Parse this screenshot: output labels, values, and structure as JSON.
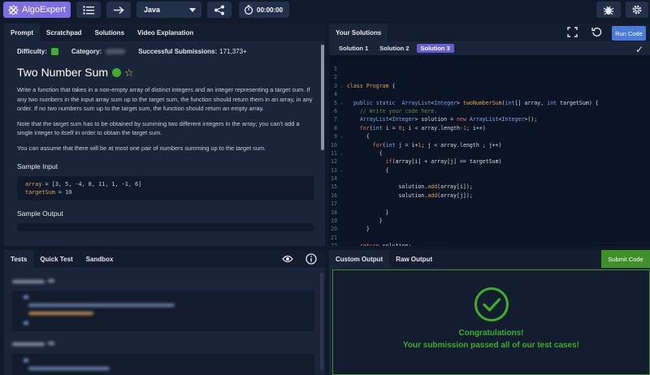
{
  "topbar": {
    "logo_text": "AlgoExpert",
    "language": "Java",
    "timer": "00:00:00"
  },
  "prompt_panel": {
    "tabs": [
      "Prompt",
      "Scratchpad",
      "Solutions",
      "Video Explanation"
    ],
    "difficulty_label": "Difficulty:",
    "category_label": "Category:",
    "submissions_label": "Successful Submissions:",
    "submissions_value": "171,373+",
    "title": "Two Number Sum",
    "description": [
      "Write a function that takes in a non-empty array of distinct integers and an integer representing a target sum. If any two numbers in the input array sum up to the target sum, the function should return them in an array, in any order. If no two numbers sum up to the target sum, the function should return an empty array.",
      "Note that the target sum has to be obtained by summing two different integers in the array; you can't add a single integer to itself in order to obtain the target sum.",
      "You can assume that there will be at most one pair of numbers summing up to the target sum."
    ],
    "sample_input_label": "Sample Input",
    "sample_input_line1_key": "array",
    "sample_input_line1_val": " = [3, 5, -4, 8, 11, 1, -1, 6]",
    "sample_input_line2_key": "targetSum",
    "sample_input_line2_val": " = 10",
    "sample_output_label": "Sample Output"
  },
  "solutions_panel": {
    "header": "Your Solutions",
    "run_label": "Run Code",
    "solution_tabs": [
      "Solution 1",
      "Solution 2",
      "Solution 3"
    ],
    "active_solution": "Solution 3",
    "code_lines": [
      {
        "n": "1",
        "fold": "",
        "tokens": [
          {
            "c": "c-txt",
            "t": ""
          }
        ]
      },
      {
        "n": "2",
        "fold": "",
        "tokens": [
          {
            "c": "c-txt",
            "t": ""
          }
        ]
      },
      {
        "n": "3",
        "fold": "⌄",
        "tokens": [
          {
            "c": "c-ora",
            "t": "class "
          },
          {
            "c": "c-ora",
            "t": "Program"
          },
          {
            "c": "c-txt",
            "t": " {"
          }
        ]
      },
      {
        "n": "4",
        "fold": "",
        "tokens": [
          {
            "c": "c-txt",
            "t": ""
          }
        ]
      },
      {
        "n": "5",
        "fold": "⌄",
        "tokens": [
          {
            "c": "c-txt",
            "t": "  "
          },
          {
            "c": "c-blue",
            "t": "public static  "
          },
          {
            "c": "c-blue",
            "t": "ArrayList"
          },
          {
            "c": "c-txt",
            "t": "<"
          },
          {
            "c": "c-blue",
            "t": "Integer"
          },
          {
            "c": "c-txt",
            "t": "> "
          },
          {
            "c": "c-ora",
            "t": "twoNumberSum"
          },
          {
            "c": "c-txt",
            "t": "("
          },
          {
            "c": "c-blue",
            "t": "int"
          },
          {
            "c": "c-txt",
            "t": "[] array, "
          },
          {
            "c": "c-blue",
            "t": "int"
          },
          {
            "c": "c-txt",
            "t": " targetSum) {"
          }
        ]
      },
      {
        "n": "6",
        "fold": "",
        "tokens": [
          {
            "c": "c-cm",
            "t": "    // Write your code here."
          }
        ]
      },
      {
        "n": "7",
        "fold": "",
        "tokens": [
          {
            "c": "c-txt",
            "t": "    "
          },
          {
            "c": "c-blue",
            "t": "ArrayList"
          },
          {
            "c": "c-txt",
            "t": "<"
          },
          {
            "c": "c-blue",
            "t": "Integer"
          },
          {
            "c": "c-txt",
            "t": "> solution = "
          },
          {
            "c": "c-red",
            "t": "new "
          },
          {
            "c": "c-blue",
            "t": "ArrayList"
          },
          {
            "c": "c-txt",
            "t": "<"
          },
          {
            "c": "c-blue",
            "t": "Integer"
          },
          {
            "c": "c-txt",
            "t": ">();"
          }
        ]
      },
      {
        "n": "8",
        "fold": "",
        "tokens": [
          {
            "c": "c-txt",
            "t": "    "
          },
          {
            "c": "c-red",
            "t": "for"
          },
          {
            "c": "c-txt",
            "t": "("
          },
          {
            "c": "c-blue",
            "t": "int"
          },
          {
            "c": "c-txt",
            "t": " i = "
          },
          {
            "c": "c-red",
            "t": "0"
          },
          {
            "c": "c-txt",
            "t": "; i < array.length-"
          },
          {
            "c": "c-red",
            "t": "1"
          },
          {
            "c": "c-txt",
            "t": "; i++)"
          }
        ]
      },
      {
        "n": "9",
        "fold": "⌄",
        "tokens": [
          {
            "c": "c-txt",
            "t": "      {"
          }
        ]
      },
      {
        "n": "10",
        "fold": "",
        "tokens": [
          {
            "c": "c-txt",
            "t": "        "
          },
          {
            "c": "c-red",
            "t": "for"
          },
          {
            "c": "c-txt",
            "t": "("
          },
          {
            "c": "c-blue",
            "t": "int"
          },
          {
            "c": "c-txt",
            "t": " j = i+"
          },
          {
            "c": "c-red",
            "t": "1"
          },
          {
            "c": "c-txt",
            "t": "; j < array.length ; j++)"
          }
        ]
      },
      {
        "n": "11",
        "fold": "⌄",
        "tokens": [
          {
            "c": "c-txt",
            "t": "          {"
          }
        ]
      },
      {
        "n": "12",
        "fold": "",
        "tokens": [
          {
            "c": "c-txt",
            "t": "            "
          },
          {
            "c": "c-red",
            "t": "if"
          },
          {
            "c": "c-txt",
            "t": "(array[i] + array[j] == targetSum)"
          }
        ]
      },
      {
        "n": "13",
        "fold": "⌄",
        "tokens": [
          {
            "c": "c-txt",
            "t": "            {"
          }
        ]
      },
      {
        "n": "14",
        "fold": "",
        "tokens": [
          {
            "c": "c-txt",
            "t": ""
          }
        ]
      },
      {
        "n": "15",
        "fold": "",
        "tokens": [
          {
            "c": "c-txt",
            "t": "                solution."
          },
          {
            "c": "c-ora",
            "t": "add"
          },
          {
            "c": "c-txt",
            "t": "(array[i]);"
          }
        ]
      },
      {
        "n": "16",
        "fold": "",
        "tokens": [
          {
            "c": "c-txt",
            "t": "                solution."
          },
          {
            "c": "c-ora",
            "t": "add"
          },
          {
            "c": "c-txt",
            "t": "(array[j]);"
          }
        ]
      },
      {
        "n": "17",
        "fold": "",
        "tokens": [
          {
            "c": "c-txt",
            "t": ""
          }
        ]
      },
      {
        "n": "18",
        "fold": "",
        "tokens": [
          {
            "c": "c-txt",
            "t": "            }"
          }
        ]
      },
      {
        "n": "19",
        "fold": "",
        "tokens": [
          {
            "c": "c-txt",
            "t": "          }"
          }
        ]
      },
      {
        "n": "20",
        "fold": "",
        "tokens": [
          {
            "c": "c-txt",
            "t": "      }"
          }
        ]
      },
      {
        "n": "21",
        "fold": "",
        "tokens": [
          {
            "c": "c-txt",
            "t": ""
          }
        ]
      },
      {
        "n": "22",
        "fold": "",
        "tokens": [
          {
            "c": "c-txt",
            "t": "    "
          },
          {
            "c": "c-red",
            "t": "return"
          },
          {
            "c": "c-txt",
            "t": " solution;"
          }
        ]
      },
      {
        "n": "23",
        "fold": "",
        "tokens": [
          {
            "c": "c-txt",
            "t": "  }"
          }
        ]
      },
      {
        "n": "24",
        "fold": "",
        "tokens": [
          {
            "c": "c-txt",
            "t": "}"
          }
        ]
      }
    ]
  },
  "tests_panel": {
    "tabs": [
      "Tests",
      "Quick Test",
      "Sandbox"
    ]
  },
  "output_panel": {
    "tabs": [
      "Custom Output",
      "Raw Output"
    ],
    "submit_label": "Submit Code",
    "congrats": "Congratulations!",
    "passed": "Your submission passed all of our test cases!"
  },
  "colors": {
    "accent_purple": "#7e6ee6",
    "run_blue": "#4a7bd8",
    "success_green": "#3cae2a"
  }
}
